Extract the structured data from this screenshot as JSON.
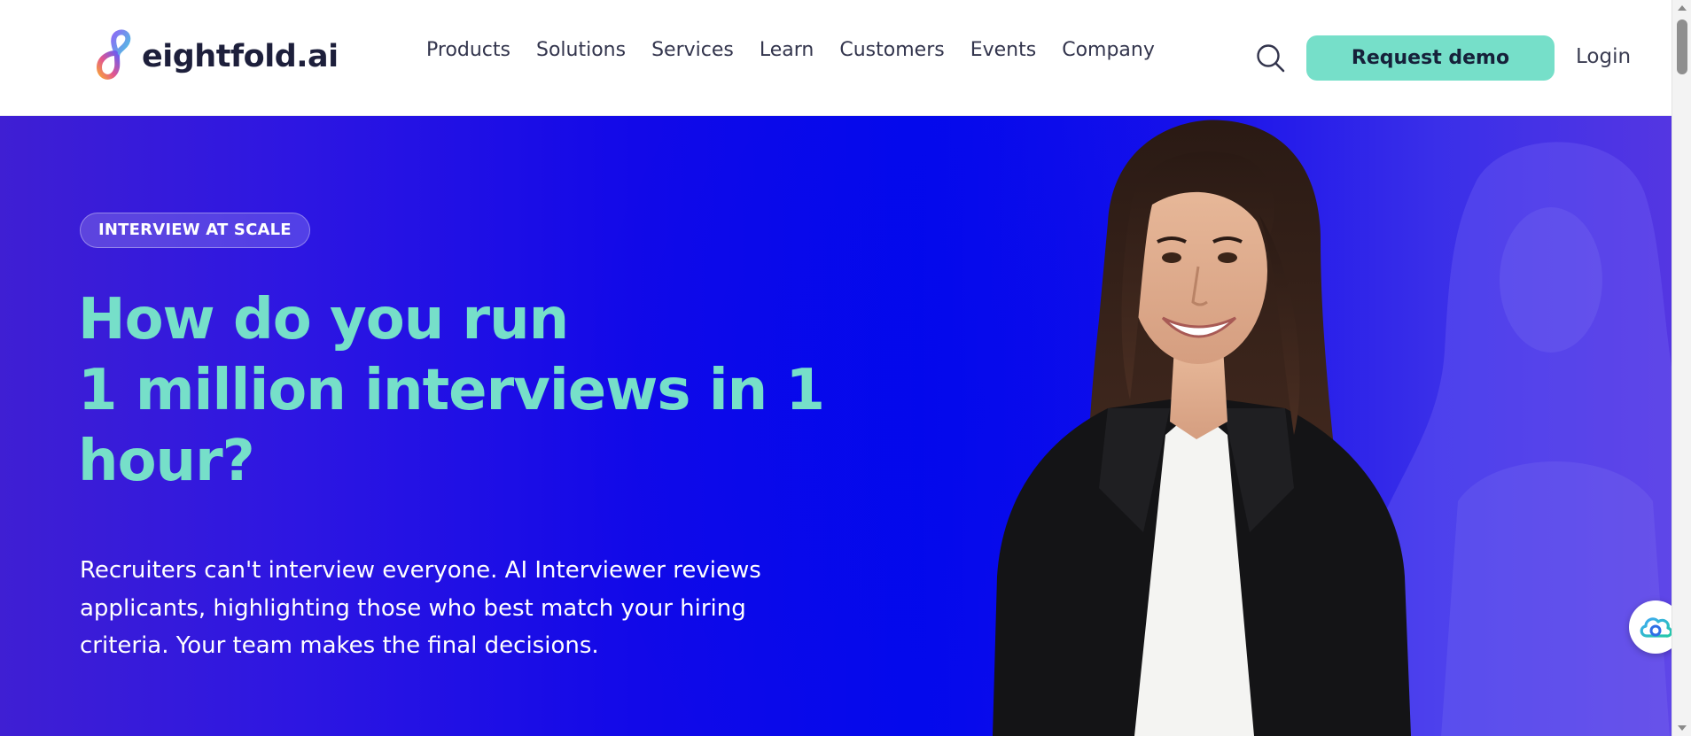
{
  "header": {
    "logo_text": "eightfold.ai",
    "nav": [
      "Products",
      "Solutions",
      "Services",
      "Learn",
      "Customers",
      "Events",
      "Company"
    ],
    "search_icon": "search-icon",
    "request_demo_label": "Request demo",
    "login_label": "Login"
  },
  "hero": {
    "badge": "INTERVIEW AT SCALE",
    "headline_lines": [
      "How do you run",
      "1 million interviews in 1",
      "hour?"
    ],
    "lede": "Recruiters can't interview everyone. AI Interviewer reviews applicants, highlighting those who best match your hiring criteria. Your team makes the final decisions."
  },
  "widget": {
    "icon": "cloud-assistant-icon"
  },
  "colors": {
    "accent_mint": "#76dfc9",
    "hero_blue": "#0409ec",
    "hero_purple": "#3f1fd3",
    "text_dark": "#1d1f3b"
  }
}
